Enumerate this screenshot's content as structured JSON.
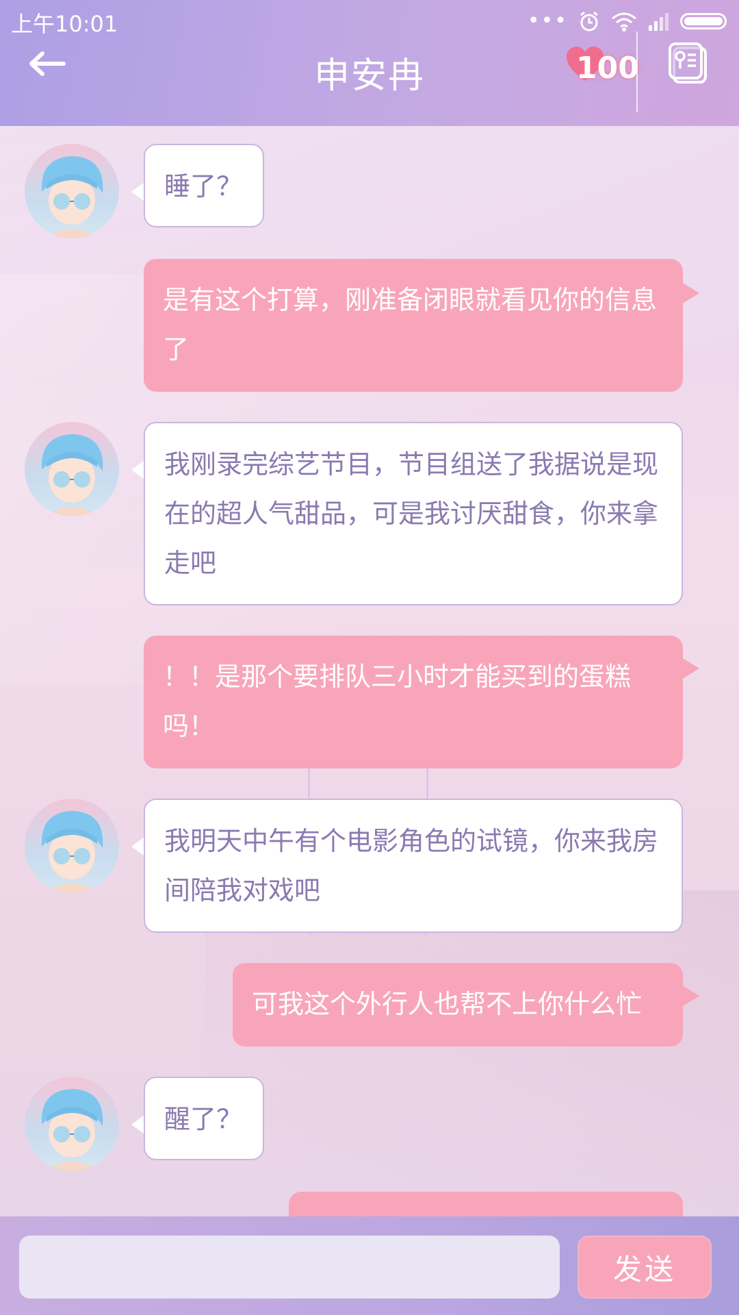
{
  "status_bar": {
    "time": "上午10:01",
    "dots": "•••",
    "icons": [
      "alarm-icon",
      "wifi-icon",
      "signal-icon",
      "battery-icon"
    ]
  },
  "header": {
    "title": "申安冉",
    "affinity_value": "100",
    "back_icon": "back-arrow-icon",
    "profile_icon": "profile-card-icon"
  },
  "messages": [
    {
      "from": "contact",
      "text": "睡了？"
    },
    {
      "from": "me",
      "text": "是有这个打算，刚准备闭眼就看见你的信息了"
    },
    {
      "from": "contact",
      "text": "我刚录完综艺节目，节目组送了我据说是现在的超人气甜品，可是我讨厌甜食，你来拿走吧"
    },
    {
      "from": "me",
      "text": "！！是那个要排队三小时才能买到的蛋糕吗！"
    },
    {
      "from": "contact",
      "text": "我明天中午有个电影角色的试镜，你来我房间陪我对戏吧"
    },
    {
      "from": "me",
      "text": "可我这个外行人也帮不上你什么忙"
    },
    {
      "from": "contact",
      "text": "醒了？"
    },
    {
      "from": "me",
      "text": ""
    }
  ],
  "input": {
    "value": "",
    "placeholder": "",
    "send_label": "发送"
  },
  "colors": {
    "header_gradient_start": "#ad9fe4",
    "header_gradient_end": "#cfa6de",
    "outgoing_bubble": "#f8a5ba",
    "incoming_bubble": "#ffffff",
    "incoming_text": "#8a7ab0",
    "input_bg": "#e9e5f4"
  }
}
